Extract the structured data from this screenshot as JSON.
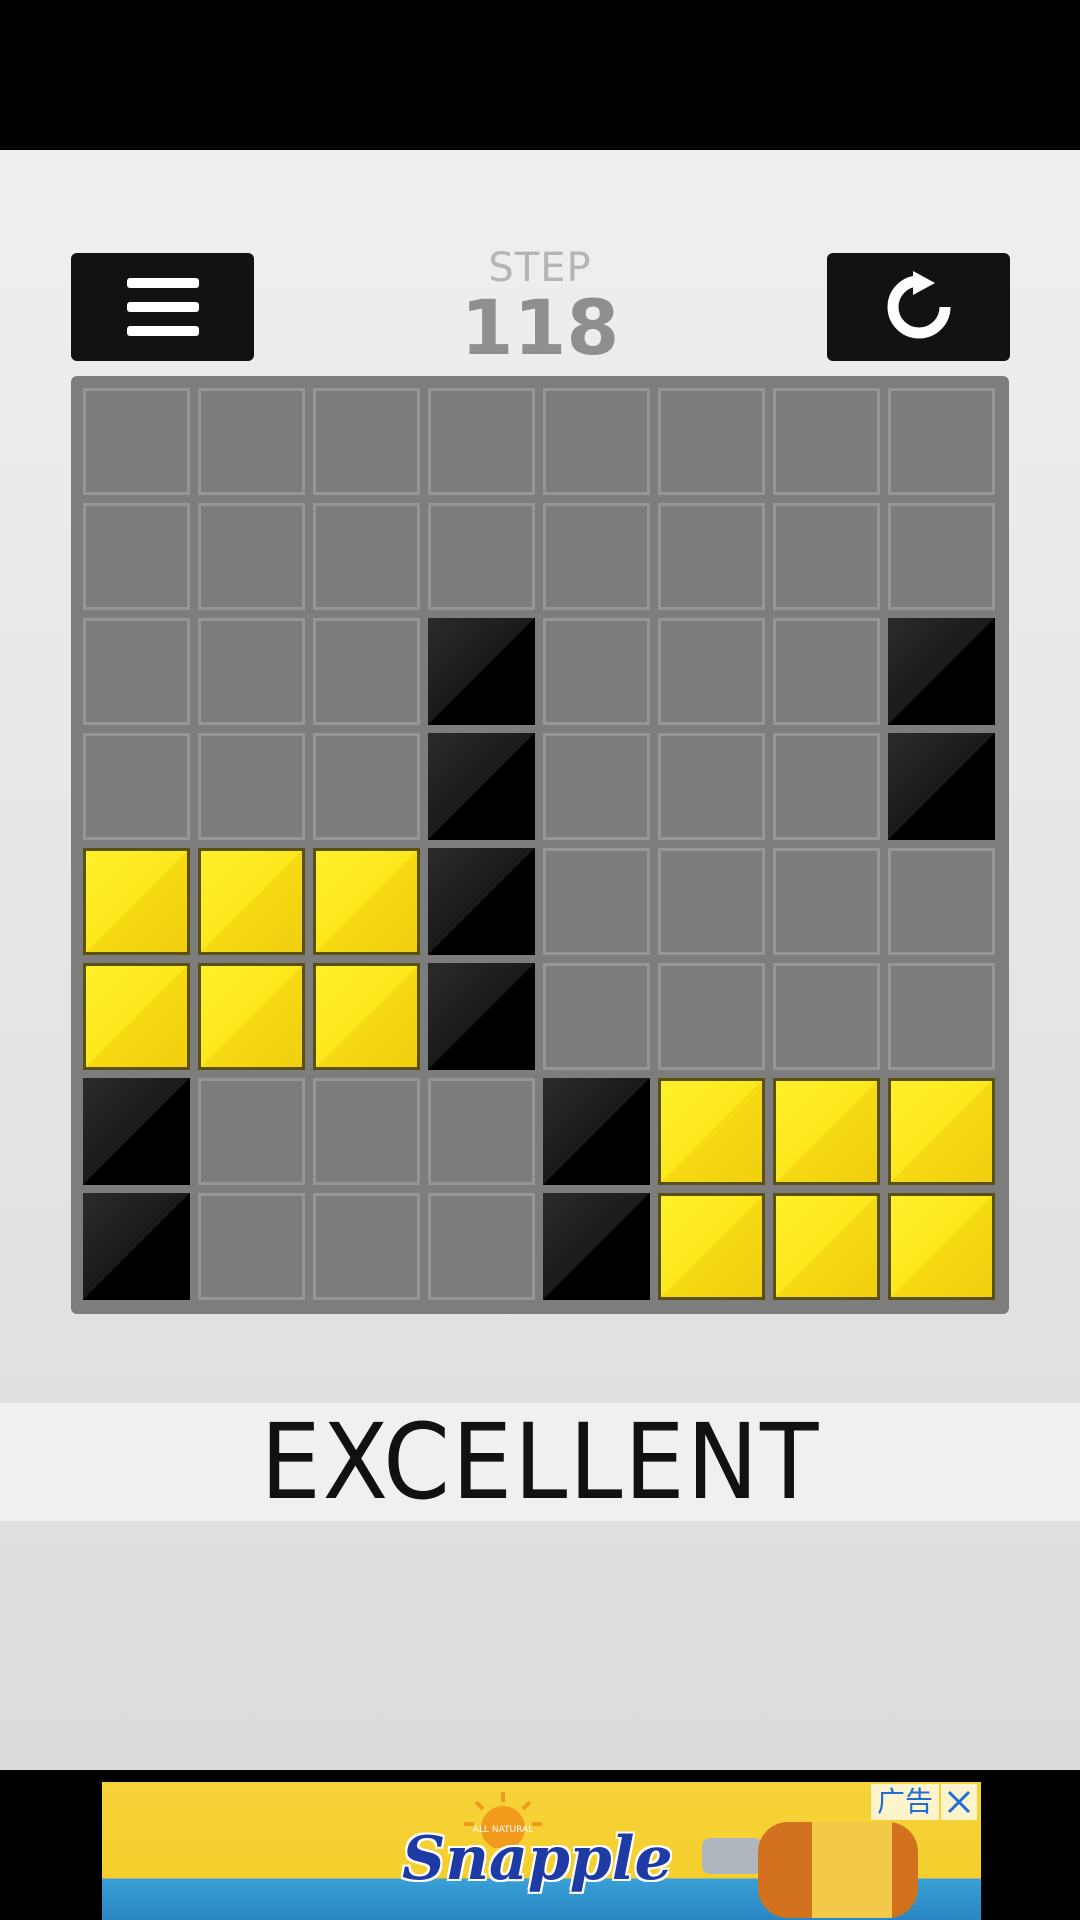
{
  "header": {
    "menu_icon": "hamburger-menu-icon",
    "restart_icon": "restart-arrow-icon",
    "step_label": "STEP",
    "step_value": "118"
  },
  "board": {
    "cols": 8,
    "rows": 8,
    "cells": [
      [
        "empty",
        "empty",
        "empty",
        "empty",
        "empty",
        "empty",
        "empty",
        "empty"
      ],
      [
        "empty",
        "empty",
        "empty",
        "empty",
        "empty",
        "empty",
        "empty",
        "empty"
      ],
      [
        "empty",
        "empty",
        "empty",
        "black",
        "empty",
        "empty",
        "empty",
        "black"
      ],
      [
        "empty",
        "empty",
        "empty",
        "black",
        "empty",
        "empty",
        "empty",
        "black"
      ],
      [
        "yellow",
        "yellow",
        "yellow",
        "black",
        "empty",
        "empty",
        "empty",
        "empty"
      ],
      [
        "yellow",
        "yellow",
        "yellow",
        "black",
        "empty",
        "empty",
        "empty",
        "empty"
      ],
      [
        "black",
        "empty",
        "empty",
        "empty",
        "black",
        "yellow",
        "yellow",
        "yellow"
      ],
      [
        "black",
        "empty",
        "empty",
        "empty",
        "black",
        "yellow",
        "yellow",
        "yellow"
      ]
    ],
    "colors": {
      "empty": "#7c7c7c",
      "black": "#000000",
      "yellow": "#fde81d"
    }
  },
  "rating": {
    "text": "EXCELLENT"
  },
  "ad": {
    "brand": "Snapple",
    "sun_text": "ALL NATURAL",
    "tag": "广告",
    "close_icon": "close-icon"
  }
}
